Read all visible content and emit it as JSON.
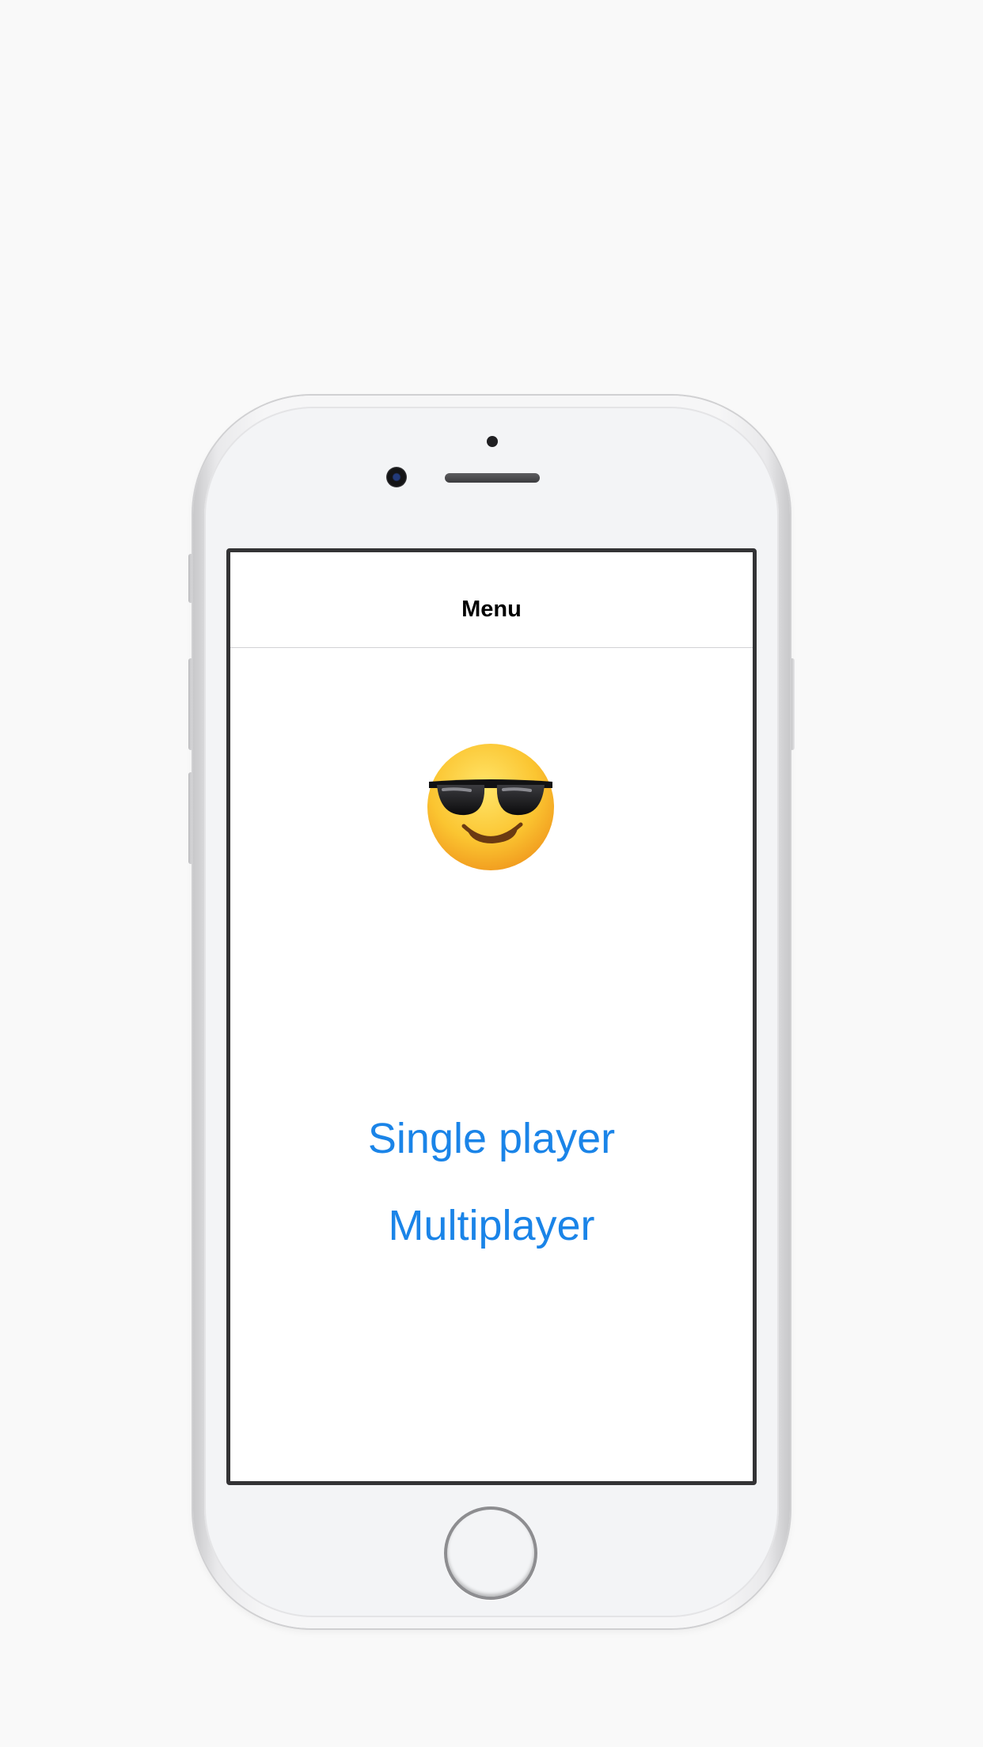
{
  "nav": {
    "title": "Menu"
  },
  "content": {
    "emoji": "smiling-face-with-sunglasses",
    "single_player_label": "Single player",
    "multiplayer_label": "Multiplayer"
  },
  "colors": {
    "accent": "#1a84e8",
    "background": "#f9f9f9",
    "screen": "#ffffff",
    "bezel": "#f3f4f6"
  }
}
